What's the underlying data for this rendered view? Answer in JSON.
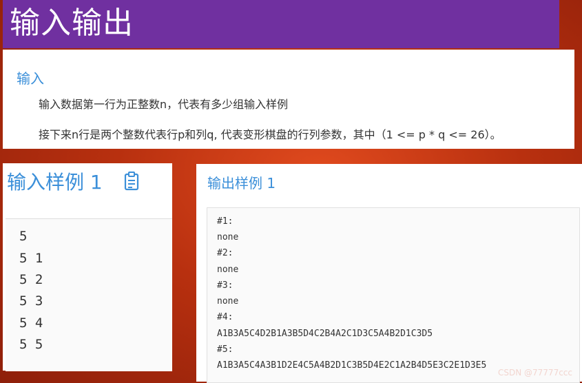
{
  "title": "输入输出",
  "input_section": {
    "heading": "输入",
    "line1": "输入数据第一行为正整数n，代表有多少组输入样例",
    "line2": "接下来n行是两个整数代表行p和列q, 代表变形棋盘的行列参数，其中（1 <= p * q <= 26）。"
  },
  "input_sample": {
    "heading": "输入样例 1",
    "copy_icon": "clipboard-icon",
    "lines": [
      "5",
      "5 1",
      "5 2",
      "5 3",
      "5 4",
      "5 5"
    ]
  },
  "output_sample": {
    "heading": "输出样例 1",
    "lines": [
      "#1:",
      "none",
      "#2:",
      "none",
      "#3:",
      "none",
      "#4:",
      "A1B3A5C4D2B1A3B5D4C2B4A2C1D3C5A4B2D1C3D5",
      "#5:",
      "A1B3A5C4A3B1D2E4C5A4B2D1C3B5D4E2C1A2B4D5E3C2E1D3E5"
    ]
  },
  "watermark": "CSDN @77777ccc",
  "colors": {
    "accent": "#3b8fd9",
    "title_bg": "#7030a0"
  }
}
